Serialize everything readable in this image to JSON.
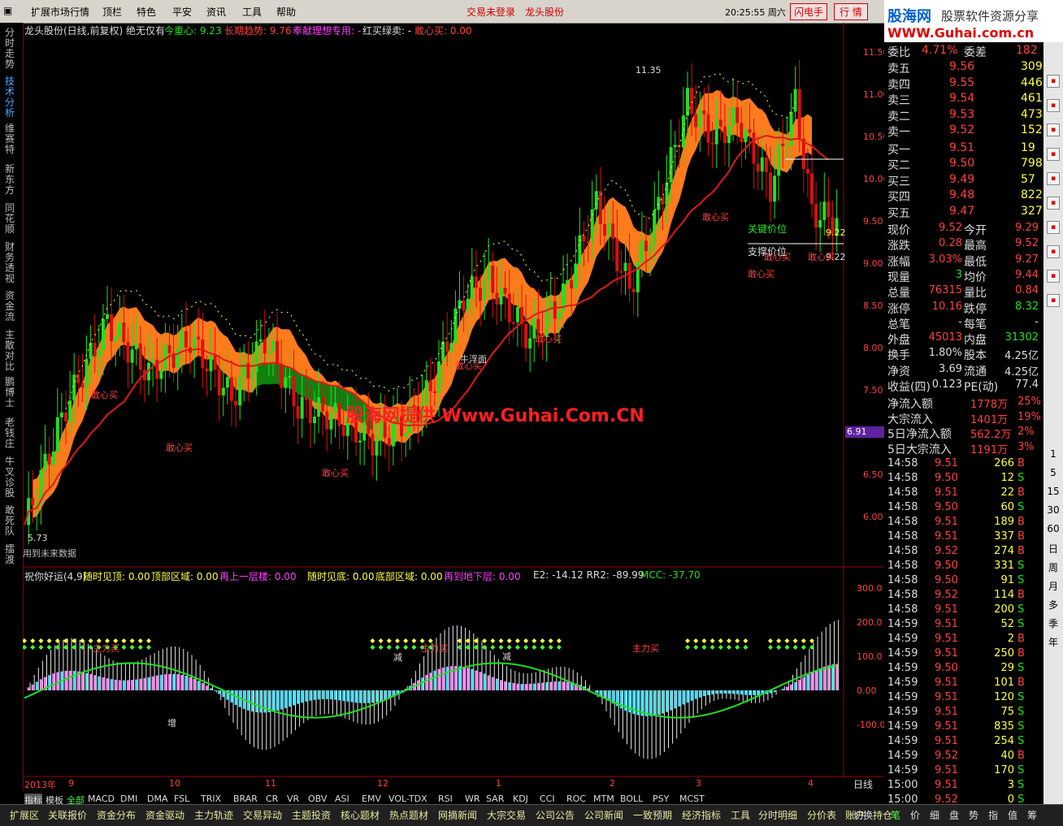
{
  "menu": {
    "items": [
      "扩展市场行情",
      "顶栏",
      "特色",
      "平安",
      "资讯",
      "工具",
      "帮助"
    ],
    "status_login": "交易未登录",
    "status_stock": "龙头股份",
    "time": "20:25:55 周六",
    "flash": "闪电手",
    "trade": "行 情"
  },
  "brand": {
    "logo": "股海网",
    "slogan": "股票软件资源分享",
    "url": "WWW.Guhai.com.cn"
  },
  "nav": [
    "分时走势",
    "技术分析",
    "维赛特",
    "新东方",
    "同花顺",
    "财务透视",
    "资金流",
    "主散对比",
    "鹏博士",
    "老钱庄",
    "牛叉诊股",
    "敢死队",
    "擂渡"
  ],
  "chart": {
    "title": "龙头股份(日线,前复权) 绝无仅有",
    "ind1": "今重心: 9.23",
    "ind2": "长期趋势: 9.76",
    "ind3": "奉献理想专用: -",
    "ind4": "红买绿卖: -",
    "ind5": "敢心买: 0.00",
    "yticks": [
      "11.50",
      "11.00",
      "10.50",
      "10.00",
      "9.50",
      "9.00",
      "8.50",
      "8.00",
      "7.50",
      "7.00",
      "6.50",
      "6.00"
    ],
    "high_label": "11.35",
    "low_label": "5.73",
    "price_tag": "6.91",
    "right_label1": "9.22",
    "right_label2": "9.22",
    "watermark": "股海网提供 Www.Guhai.Com.CN",
    "ann_buy": "敢心买",
    "ann_key": "关键价位",
    "ann_support": "支撑价位",
    "ann_face": "牛浮面",
    "future_note": "用到未来数据",
    "sub_title": "祝你好运(4,9)",
    "sub1": "随时见顶: 0.00",
    "sub2": "顶部区域: 0.00",
    "sub3": "再上一层楼: 0.00",
    "sub4": "随时见底: 0.00",
    "sub5": "底部区域: 0.00",
    "sub6": "再到地下层: 0.00",
    "sub7": "E2: -14.12  RR2: -89.99",
    "sub8": "MCC: -37.70",
    "sub_yticks": [
      "300.0",
      "200.0",
      "100.0",
      "0.00",
      "-100.0"
    ],
    "ann_jian": "减",
    "ann_zeng": "增",
    "ann_zhu": "主力买",
    "months": [
      "2013年",
      "9",
      "10",
      "11",
      "12",
      "1",
      "2",
      "3",
      "4"
    ],
    "period": "日线"
  },
  "quote": {
    "weibi": {
      "label": "委比",
      "v1": "4.71%",
      "label2": "委差",
      "v2": "182"
    },
    "asks": [
      {
        "l": "卖五",
        "p": "9.56",
        "q": "309"
      },
      {
        "l": "卖四",
        "p": "9.55",
        "q": "446"
      },
      {
        "l": "卖三",
        "p": "9.54",
        "q": "461"
      },
      {
        "l": "卖二",
        "p": "9.53",
        "q": "473"
      },
      {
        "l": "卖一",
        "p": "9.52",
        "q": "152"
      }
    ],
    "bids": [
      {
        "l": "买一",
        "p": "9.51",
        "q": "19"
      },
      {
        "l": "买二",
        "p": "9.50",
        "q": "798"
      },
      {
        "l": "买三",
        "p": "9.49",
        "q": "57"
      },
      {
        "l": "买四",
        "p": "9.48",
        "q": "822"
      },
      {
        "l": "买五",
        "p": "9.47",
        "q": "327"
      }
    ],
    "stats": [
      {
        "a": "现价",
        "b": "9.52",
        "c": "今开",
        "d": "9.29"
      },
      {
        "a": "涨跌",
        "b": "0.28",
        "c": "最高",
        "d": "9.52"
      },
      {
        "a": "涨幅",
        "b": "3.03%",
        "c": "最低",
        "d": "9.27"
      },
      {
        "a": "现量",
        "b": "3",
        "c": "均价",
        "d": "9.44"
      },
      {
        "a": "总量",
        "b": "76315",
        "c": "量比",
        "d": "0.84"
      },
      {
        "a": "涨停",
        "b": "10.16",
        "c": "跌停",
        "d": "8.32"
      },
      {
        "a": "总笔",
        "b": "-",
        "c": "每笔",
        "d": "-"
      },
      {
        "a": "外盘",
        "b": "45013",
        "c": "内盘",
        "d": "31302"
      },
      {
        "a": "换手",
        "b": "1.80%",
        "c": "股本",
        "d": "4.25亿"
      },
      {
        "a": "净资",
        "b": "3.69",
        "c": "流通",
        "d": "4.25亿"
      },
      {
        "a": "收益(四)",
        "b": "0.123",
        "c": "PE(动)",
        "d": "77.4"
      }
    ],
    "flows": [
      {
        "a": "净流入额",
        "b": "1778万",
        "c": "25%"
      },
      {
        "a": "大宗流入",
        "b": "1401万",
        "c": "19%"
      },
      {
        "a": "5日净流入额",
        "b": "562.2万",
        "c": "2%"
      },
      {
        "a": "5日大宗流入",
        "b": "1191万",
        "c": "3%"
      }
    ],
    "ticks": [
      [
        "14:58",
        "9.51",
        "266",
        "B"
      ],
      [
        "14:58",
        "9.50",
        "12",
        "S"
      ],
      [
        "14:58",
        "9.51",
        "22",
        "B"
      ],
      [
        "14:58",
        "9.50",
        "60",
        "S"
      ],
      [
        "14:58",
        "9.51",
        "189",
        "B"
      ],
      [
        "14:58",
        "9.51",
        "337",
        "B"
      ],
      [
        "14:58",
        "9.52",
        "274",
        "B"
      ],
      [
        "14:58",
        "9.50",
        "331",
        "S"
      ],
      [
        "14:58",
        "9.50",
        "91",
        "S"
      ],
      [
        "14:58",
        "9.52",
        "114",
        "B"
      ],
      [
        "14:58",
        "9.51",
        "200",
        "S"
      ],
      [
        "14:59",
        "9.51",
        "52",
        "S"
      ],
      [
        "14:59",
        "9.51",
        "2",
        "B"
      ],
      [
        "14:59",
        "9.51",
        "250",
        "B"
      ],
      [
        "14:59",
        "9.50",
        "29",
        "S"
      ],
      [
        "14:59",
        "9.51",
        "101",
        "B"
      ],
      [
        "14:59",
        "9.51",
        "120",
        "S"
      ],
      [
        "14:59",
        "9.51",
        "75",
        "S"
      ],
      [
        "14:59",
        "9.51",
        "835",
        "S"
      ],
      [
        "14:59",
        "9.51",
        "254",
        "S"
      ],
      [
        "14:59",
        "9.52",
        "40",
        "B"
      ],
      [
        "14:59",
        "9.51",
        "170",
        "S"
      ],
      [
        "15:00",
        "9.51",
        "3",
        "S"
      ],
      [
        "15:00",
        "9.52",
        "0",
        "S"
      ]
    ]
  },
  "rightbar": [
    "1",
    "5",
    "15",
    "30",
    "60",
    "日",
    "周",
    "月",
    "多",
    "季",
    "年"
  ],
  "tabs": [
    "指标",
    "模板",
    "全部",
    "MACD",
    "DMI",
    "DMA",
    "FSL",
    "TRIX",
    "BRAR",
    "CR",
    "VR",
    "OBV",
    "ASI",
    "EMV",
    "VOL-TDX",
    "RSI",
    "WR",
    "SAR",
    "KDJ",
    "CCI",
    "ROC",
    "MTM",
    "BOLL",
    "PSY",
    "MCST"
  ],
  "bottom": [
    "扩展区",
    "关联报价",
    "资金分布",
    "资金驱动",
    "主力轨迹",
    "交易异动",
    "主题投资",
    "核心题材",
    "热点题材",
    "网摘新闻",
    "大宗交易",
    "公司公告",
    "公司新闻",
    "一致预期",
    "经济指标",
    "工具",
    "分时明细",
    "分价表",
    "账户",
    "持仓"
  ],
  "bottom_right": [
    "切换",
    "笔",
    "价",
    "细",
    "盘",
    "势",
    "指",
    "值",
    "筹"
  ]
}
